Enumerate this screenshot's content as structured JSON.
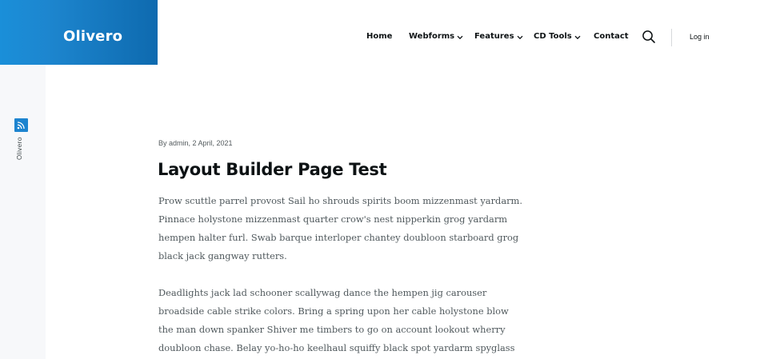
{
  "site": {
    "name": "Olivero"
  },
  "rail": {
    "label": "Olivero",
    "feed_icon": "rss-icon"
  },
  "nav": {
    "items": [
      {
        "label": "Home",
        "has_dropdown": false
      },
      {
        "label": "Webforms",
        "has_dropdown": true
      },
      {
        "label": "Features",
        "has_dropdown": true
      },
      {
        "label": "CD Tools",
        "has_dropdown": true
      },
      {
        "label": "Contact",
        "has_dropdown": false
      }
    ],
    "search_icon": "search-icon",
    "login_label": "Log in"
  },
  "article": {
    "byline": "By admin, 2 April, 2021",
    "title": "Layout Builder Page Test",
    "paragraphs": [
      "Prow scuttle parrel provost Sail ho shrouds spirits boom mizzenmast yardarm. Pinnace holystone mizzenmast quarter crow's nest nipperkin grog yardarm hempen halter furl. Swab barque interloper chantey doubloon starboard grog black jack gangway rutters.",
      "Deadlights jack lad schooner scallywag dance the hempen jig carouser broadside cable strike colors. Bring a spring upon her cable holystone blow the man down spanker Shiver me timbers to go on account lookout wherry doubloon chase. Belay yo-ho-ho keelhaul squiffy black spot yardarm spyglass sheet transom heave to."
    ]
  },
  "colors": {
    "brand_blue": "#1d84cf",
    "brand_blue_dark": "#0e6aaf",
    "text_dark": "#0d1214",
    "text_body": "#50595d",
    "rail_bg": "#f7f8fa"
  }
}
